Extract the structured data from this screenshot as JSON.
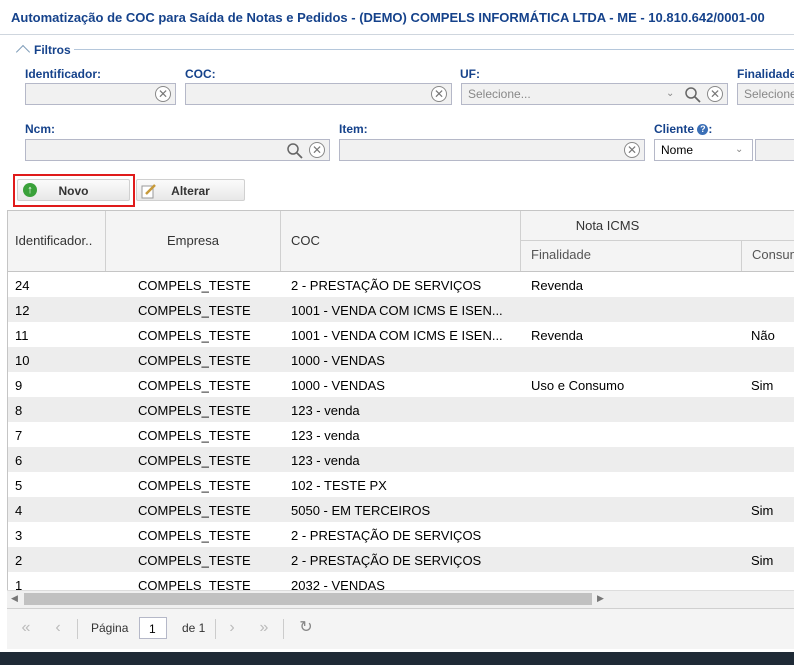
{
  "window": {
    "title": "Automatização de COC para Saída de Notas e Pedidos - (DEMO) COMPELS INFORMÁTICA LTDA - ME - 10.810.642/0001-00"
  },
  "filters": {
    "legend": "Filtros",
    "identificador": {
      "label": "Identificador:",
      "value": ""
    },
    "coc": {
      "label": "COC:",
      "value": ""
    },
    "uf": {
      "label": "UF:",
      "placeholder": "Selecione..."
    },
    "finalidade": {
      "label": "Finalidade",
      "placeholder": "Selecione"
    },
    "ncm": {
      "label": "Ncm:",
      "value": ""
    },
    "item": {
      "label": "Item:",
      "value": ""
    },
    "cliente": {
      "label": "Cliente",
      "selected": "Nome"
    }
  },
  "toolbar": {
    "novo": "Novo",
    "alterar": "Alterar"
  },
  "grid": {
    "headers": {
      "identificador": "Identificador..",
      "empresa": "Empresa",
      "coc": "COC",
      "nota_icms": "Nota ICMS",
      "finalidade": "Finalidade",
      "consumo": "Consum"
    },
    "rows": [
      {
        "id": "24",
        "empresa": "COMPELS_TESTE",
        "coc": "2 - PRESTAÇÃO DE SERVIÇOS",
        "finalidade": "Revenda",
        "consumo": ""
      },
      {
        "id": "12",
        "empresa": "COMPELS_TESTE",
        "coc": "1001 - VENDA COM ICMS E ISEN...",
        "finalidade": "",
        "consumo": ""
      },
      {
        "id": "11",
        "empresa": "COMPELS_TESTE",
        "coc": "1001 - VENDA COM ICMS E ISEN...",
        "finalidade": "Revenda",
        "consumo": "Não"
      },
      {
        "id": "10",
        "empresa": "COMPELS_TESTE",
        "coc": "1000 - VENDAS",
        "finalidade": "",
        "consumo": ""
      },
      {
        "id": "9",
        "empresa": "COMPELS_TESTE",
        "coc": "1000 - VENDAS",
        "finalidade": "Uso e Consumo",
        "consumo": "Sim"
      },
      {
        "id": "8",
        "empresa": "COMPELS_TESTE",
        "coc": "123 - venda",
        "finalidade": "",
        "consumo": ""
      },
      {
        "id": "7",
        "empresa": "COMPELS_TESTE",
        "coc": "123 - venda",
        "finalidade": "",
        "consumo": ""
      },
      {
        "id": "6",
        "empresa": "COMPELS_TESTE",
        "coc": "123 - venda",
        "finalidade": "",
        "consumo": ""
      },
      {
        "id": "5",
        "empresa": "COMPELS_TESTE",
        "coc": "102 - TESTE PX",
        "finalidade": "",
        "consumo": ""
      },
      {
        "id": "4",
        "empresa": "COMPELS_TESTE",
        "coc": "5050 - EM TERCEIROS",
        "finalidade": "",
        "consumo": "Sim"
      },
      {
        "id": "3",
        "empresa": "COMPELS_TESTE",
        "coc": "2 - PRESTAÇÃO DE SERVIÇOS",
        "finalidade": "",
        "consumo": ""
      },
      {
        "id": "2",
        "empresa": "COMPELS_TESTE",
        "coc": "2 - PRESTAÇÃO DE SERVIÇOS",
        "finalidade": "",
        "consumo": "Sim"
      },
      {
        "id": "1",
        "empresa": "COMPELS_TESTE",
        "coc": "2032 - VENDAS",
        "finalidade": "",
        "consumo": ""
      }
    ]
  },
  "pager": {
    "page_label": "Página",
    "page": "1",
    "of_label": "de 1"
  },
  "colors": {
    "title": "#15428b",
    "highlight": "#e01b1b"
  }
}
